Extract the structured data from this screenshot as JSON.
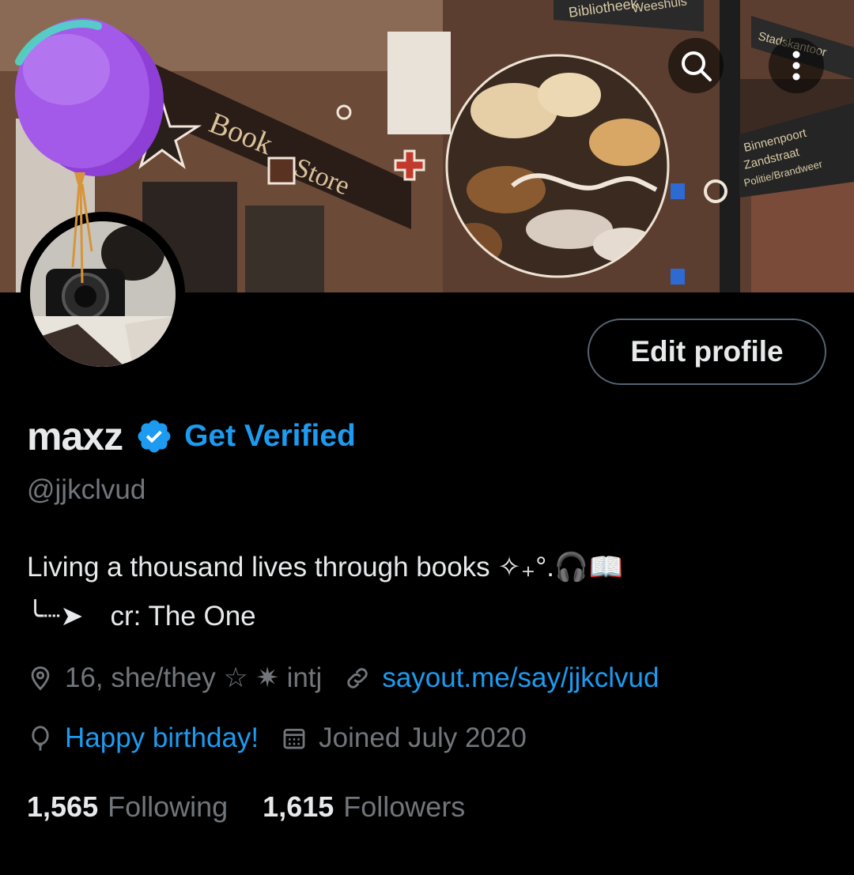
{
  "profile": {
    "name": "maxz",
    "get_verified_label": "Get Verified",
    "handle": "@jjkclvud",
    "edit_profile_label": "Edit profile",
    "bio_line1": "Living a thousand lives through books ✧₊°.🎧📖",
    "bio_line2_arrow": "╰┈➤",
    "bio_line2_text": "cr: The One",
    "location": "16, she/they ☆ ✷ intj",
    "website": "sayout.me/say/jjkclvud",
    "birthday_label": "Happy birthday!",
    "joined": "Joined July 2020",
    "following_count": "1,565",
    "following_label": "Following",
    "followers_count": "1,615",
    "followers_label": "Followers"
  },
  "banner": {
    "sign_book": "Book",
    "sign_store": "Store",
    "sign_bibliotheek": "Bibliotheek",
    "sign_weeshuis": "Weeshuis",
    "sign_stadsk": "Stadskantoor",
    "sign_binnenpoort": "Binnenpoort",
    "sign_zandstraat": "Zandstraat",
    "sign_politie": "Politie/Brandweer"
  },
  "icons": {
    "search": "search-icon",
    "more": "more-vertical-icon",
    "verified": "verified-badge-icon",
    "location": "location-pin-icon",
    "link": "link-icon",
    "birthday": "balloon-icon",
    "calendar": "calendar-icon"
  },
  "colors": {
    "background": "#000000",
    "accent": "#1d9bf0",
    "text_primary": "#e7e9ea",
    "text_secondary": "#71767b",
    "border": "#536471",
    "balloon": "#9b4fe0"
  }
}
